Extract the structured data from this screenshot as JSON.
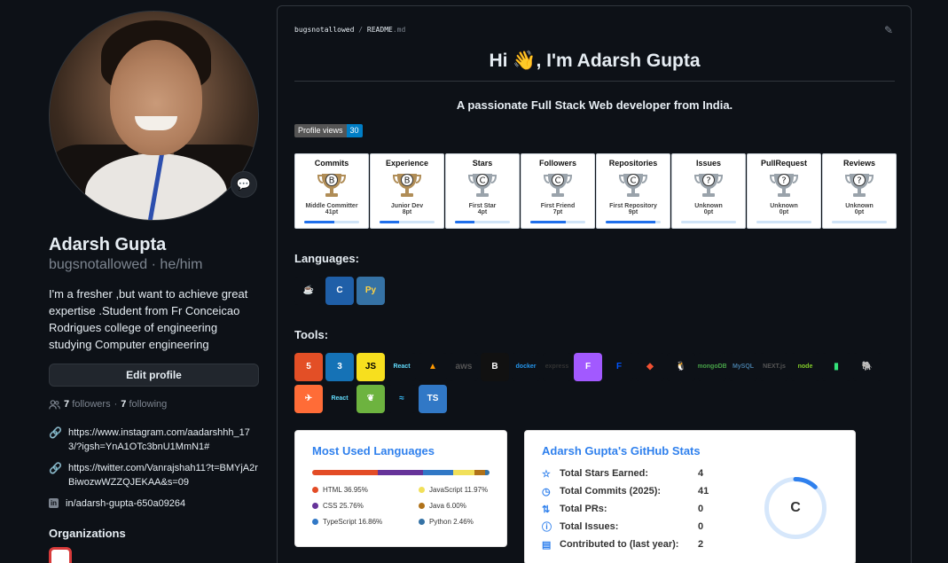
{
  "profile": {
    "name": "Adarsh Gupta",
    "login": "bugsnotallowed · he/him",
    "bio": "I'm a fresher ,but want to achieve great expertise .Student from Fr Conceicao Rodrigues college of engineering studying Computer engineering",
    "edit_label": "Edit profile",
    "followers_count": "7",
    "followers_label": "followers",
    "following_count": "7",
    "following_label": "following",
    "links": [
      {
        "icon": "link-icon",
        "text": "https://www.instagram.com/aadarshhh_173/?igsh=YnA1OTc3bnU1MmN1#"
      },
      {
        "icon": "link-icon",
        "text": "https://twitter.com/Vanrajshah11?t=BMYjA2rBiwozwWZZQJEKAA&s=09"
      },
      {
        "icon": "linkedin-icon",
        "text": "in/adarsh-gupta-650a09264"
      }
    ],
    "organizations_heading": "Organizations"
  },
  "readme": {
    "crumb_user": "bugsnotallowed",
    "crumb_sep": "/",
    "crumb_file": "README",
    "crumb_ext": ".md",
    "greeting": "Hi 👋, I'm Adarsh Gupta",
    "tagline": "A passionate Full Stack Web developer from India.",
    "views_label": "Profile views",
    "views_count": "30",
    "languages_heading": "Languages:",
    "tools_heading": "Tools:"
  },
  "trophies": [
    {
      "title": "Commits",
      "rank": "B",
      "name": "Middle Committer",
      "points": "41pt",
      "progress": 0.55,
      "color": "#b08d57"
    },
    {
      "title": "Experience",
      "rank": "B",
      "name": "Junior Dev",
      "points": "8pt",
      "progress": 0.35,
      "color": "#b08d57"
    },
    {
      "title": "Stars",
      "rank": "C",
      "name": "First Star",
      "points": "4pt",
      "progress": 0.35,
      "color": "#9aa3ab"
    },
    {
      "title": "Followers",
      "rank": "C",
      "name": "First Friend",
      "points": "7pt",
      "progress": 0.65,
      "color": "#9aa3ab"
    },
    {
      "title": "Repositories",
      "rank": "C",
      "name": "First Repository",
      "points": "9pt",
      "progress": 0.9,
      "color": "#9aa3ab"
    },
    {
      "title": "Issues",
      "rank": "?",
      "name": "Unknown",
      "points": "0pt",
      "progress": 0,
      "color": "#9aa3ab"
    },
    {
      "title": "PullRequest",
      "rank": "?",
      "name": "Unknown",
      "points": "0pt",
      "progress": 0,
      "color": "#9aa3ab"
    },
    {
      "title": "Reviews",
      "rank": "?",
      "name": "Unknown",
      "points": "0pt",
      "progress": 0,
      "color": "#9aa3ab"
    }
  ],
  "languages": [
    {
      "name": "java-icon",
      "glyph": "☕",
      "bg": "#0d1117",
      "fg": "#e76f00"
    },
    {
      "name": "c-icon",
      "glyph": "C",
      "bg": "#1f5fa8",
      "fg": "#ffffff"
    },
    {
      "name": "python-icon",
      "glyph": "Py",
      "bg": "#3572a5",
      "fg": "#ffd343"
    }
  ],
  "tools": [
    {
      "name": "html5-icon",
      "glyph": "5",
      "bg": "#e34f26",
      "fg": "#ffffff"
    },
    {
      "name": "css3-icon",
      "glyph": "3",
      "bg": "#1572b6",
      "fg": "#ffffff"
    },
    {
      "name": "javascript-icon",
      "glyph": "JS",
      "bg": "#f7df1e",
      "fg": "#000000"
    },
    {
      "name": "react-icon",
      "glyph": "React",
      "bg": "#0d1117",
      "fg": "#61dafb"
    },
    {
      "name": "aws-amplify-icon",
      "glyph": "▲",
      "bg": "#0d1117",
      "fg": "#ff9900"
    },
    {
      "name": "aws-icon",
      "glyph": "aws",
      "bg": "#0d1117",
      "fg": "#555555"
    },
    {
      "name": "bootstrap-icon",
      "glyph": "B",
      "bg": "#111111",
      "fg": "#ffffff"
    },
    {
      "name": "docker-icon",
      "glyph": "docker",
      "bg": "#0d1117",
      "fg": "#2496ed"
    },
    {
      "name": "express-icon",
      "glyph": "express",
      "bg": "#0d1117",
      "fg": "#333333"
    },
    {
      "name": "figma-icon",
      "glyph": "F",
      "bg": "#a259ff",
      "fg": "#ffffff"
    },
    {
      "name": "framer-icon",
      "glyph": "F",
      "bg": "#0d1117",
      "fg": "#0055ff"
    },
    {
      "name": "git-icon",
      "glyph": "◆",
      "bg": "#0d1117",
      "fg": "#f05032"
    },
    {
      "name": "linux-icon",
      "glyph": "🐧",
      "bg": "#0d1117",
      "fg": "#ffffff"
    },
    {
      "name": "mongodb-icon",
      "glyph": "mongoDB",
      "bg": "#0d1117",
      "fg": "#47a248"
    },
    {
      "name": "mysql-icon",
      "glyph": "MySQL",
      "bg": "#0d1117",
      "fg": "#4479a1"
    },
    {
      "name": "nextjs-icon",
      "glyph": "NEXT.js",
      "bg": "#0d1117",
      "fg": "#555555"
    },
    {
      "name": "nodejs-icon",
      "glyph": "node",
      "bg": "#0d1117",
      "fg": "#83cd29"
    },
    {
      "name": "passport-icon",
      "glyph": "▮",
      "bg": "#0d1117",
      "fg": "#34e27a"
    },
    {
      "name": "postgresql-icon",
      "glyph": "🐘",
      "bg": "#0d1117",
      "fg": "#336791"
    },
    {
      "name": "postman-icon",
      "glyph": "✈",
      "bg": "#ff6c37",
      "fg": "#ffffff"
    },
    {
      "name": "react-native-icon",
      "glyph": "React",
      "bg": "#0d1117",
      "fg": "#61dafb"
    },
    {
      "name": "spring-icon",
      "glyph": "❦",
      "bg": "#6db33f",
      "fg": "#ffffff"
    },
    {
      "name": "tailwind-icon",
      "glyph": "≈",
      "bg": "#0d1117",
      "fg": "#38bdf8"
    },
    {
      "name": "typescript-icon",
      "glyph": "TS",
      "bg": "#3178c6",
      "fg": "#ffffff"
    }
  ],
  "top_langs": {
    "title": "Most Used Languages",
    "items": [
      {
        "name": "HTML",
        "pct": 36.95,
        "label": "HTML 36.95%",
        "color": "#e34c26"
      },
      {
        "name": "CSS",
        "pct": 25.76,
        "label": "CSS 25.76%",
        "color": "#663399"
      },
      {
        "name": "TypeScript",
        "pct": 16.86,
        "label": "TypeScript 16.86%",
        "color": "#3178c6"
      },
      {
        "name": "JavaScript",
        "pct": 11.97,
        "label": "JavaScript 11.97%",
        "color": "#f1e05a"
      },
      {
        "name": "Java",
        "pct": 6.0,
        "label": "Java 6.00%",
        "color": "#b07219"
      },
      {
        "name": "Python",
        "pct": 2.46,
        "label": "Python 2.46%",
        "color": "#3572a5"
      }
    ]
  },
  "stats": {
    "title": "Adarsh Gupta's GitHub Stats",
    "rank": "C",
    "rank_progress": 0.12,
    "rows": [
      {
        "icon": "star-icon",
        "glyph": "☆",
        "label": "Total Stars Earned:",
        "value": "4"
      },
      {
        "icon": "history-icon",
        "glyph": "◷",
        "label": "Total Commits (2025):",
        "value": "41"
      },
      {
        "icon": "pull-request-icon",
        "glyph": "⇅",
        "label": "Total PRs:",
        "value": "0"
      },
      {
        "icon": "issue-icon",
        "glyph": "ⓘ",
        "label": "Total Issues:",
        "value": "0"
      },
      {
        "icon": "repo-icon",
        "glyph": "▤",
        "label": "Contributed to (last year):",
        "value": "2"
      }
    ]
  }
}
